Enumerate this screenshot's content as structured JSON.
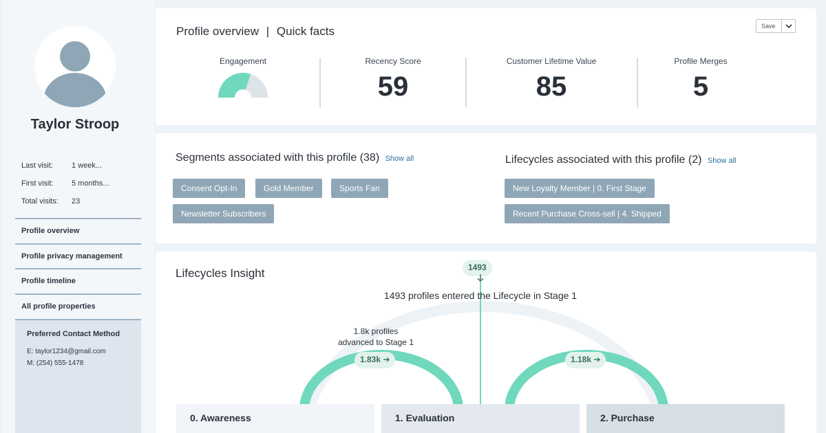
{
  "profile": {
    "name": "Taylor Stroop",
    "visits": [
      {
        "label": "Last visit:",
        "value": "1 week..."
      },
      {
        "label": "First visit:",
        "value": "5 months..."
      },
      {
        "label": "Total visits:",
        "value": "23"
      }
    ]
  },
  "sidebar": {
    "items": [
      {
        "label": "Profile overview"
      },
      {
        "label": "Profile privacy management"
      },
      {
        "label": "Profile timeline"
      },
      {
        "label": "All profile properties"
      }
    ],
    "contact": {
      "title": "Preferred Contact Method",
      "email_label": "E:",
      "email": "taylor1234@gmail.com",
      "mobile_label": "M:",
      "mobile": "(254) 555-1478"
    }
  },
  "overview": {
    "title": "Profile overview",
    "separator": "|",
    "subtitle": "Quick facts",
    "save_label": "Save",
    "metrics": {
      "engagement": {
        "label": "Engagement",
        "level": 0.6
      },
      "recency": {
        "label": "Recency Score",
        "value": "59"
      },
      "clv": {
        "label": "Customer Lifetime Value",
        "value": "85"
      },
      "merges": {
        "label": "Profile Merges",
        "value": "5"
      }
    }
  },
  "segments": {
    "title": "Segments associated with this profile (38)",
    "show_all": "Show all",
    "chips": [
      "Consent Opt-In",
      "Gold Member",
      "Sports Fan",
      "Newsletter Subscribers"
    ]
  },
  "lifecycles": {
    "title": "Lifecycles associated with this profile (2)",
    "show_all": "Show all",
    "chips": [
      "New Loyalty Member  |  0. First Stage",
      "Recent Purchase Cross-sell  |  4. Shipped"
    ]
  },
  "insight": {
    "title": "Lifecycles Insight",
    "entry_count": "1493",
    "entry_text": "1493 profiles entered the Lifecycle in Stage 1",
    "annotation_line1": "1.8k profiles",
    "annotation_line2": "advanced to Stage 1",
    "flow1": "1.83k",
    "flow2": "1.18k",
    "stages": [
      "0. Awareness",
      "1. Evaluation",
      "2. Purchase"
    ]
  },
  "colors": {
    "accent": "#6fd8bd",
    "chip": "#8fa6b6",
    "arc_background": "#edf2f7"
  }
}
